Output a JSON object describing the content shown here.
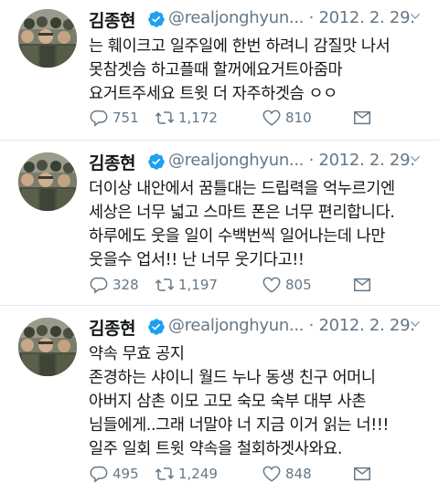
{
  "tweets": [
    {
      "name": "김종현",
      "handle": "@realjonghyun...",
      "date": "· 2012. 2. 29.",
      "lines": [
        "는 훼이크고 일주일에 한번 하려니 감질맛 나서",
        "못참겟슴 하고플때 할꺼에요거트아줌마",
        "요거트주세요 트윗 더 자주하겟슴 ㅇㅇ"
      ],
      "replies": "751",
      "retweets": "1,172",
      "likes": "810"
    },
    {
      "name": "김종현",
      "handle": "@realjonghyun...",
      "date": "· 2012. 2. 29.",
      "lines": [
        "더이상 내안에서 꿈틀대는 드립력을 억누르기엔",
        "세상은 너무 넓고 스마트 폰은 너무 편리합니다.",
        "하루에도 웃을 일이 수백번씩 일어나는데 나만",
        "웃을수 업서!! 난 너무 웃기다고!!"
      ],
      "replies": "328",
      "retweets": "1,197",
      "likes": "805"
    },
    {
      "name": "김종현",
      "handle": "@realjonghyun...",
      "date": "· 2012. 2. 29.",
      "lines": [
        "약속 무효 공지",
        "존경하는 샤이니 월드 누나 동생 친구 어머니",
        "아버지 삼촌 이모 고모 숙모 숙부 대부 사촌",
        "님들에게..그래 너말야 너 지금 이거 읽는 너!!!",
        "일주 일회 트윗 약속을 철회하겟사와요."
      ],
      "replies": "495",
      "retweets": "1,249",
      "likes": "848"
    }
  ],
  "colors": {
    "verified": "#1da1f2",
    "muted": "#657786",
    "divider": "#e1e8ed"
  },
  "icons": [
    "verified-badge-icon",
    "chevron-down-icon",
    "reply-icon",
    "retweet-icon",
    "like-icon",
    "direct-message-icon"
  ]
}
